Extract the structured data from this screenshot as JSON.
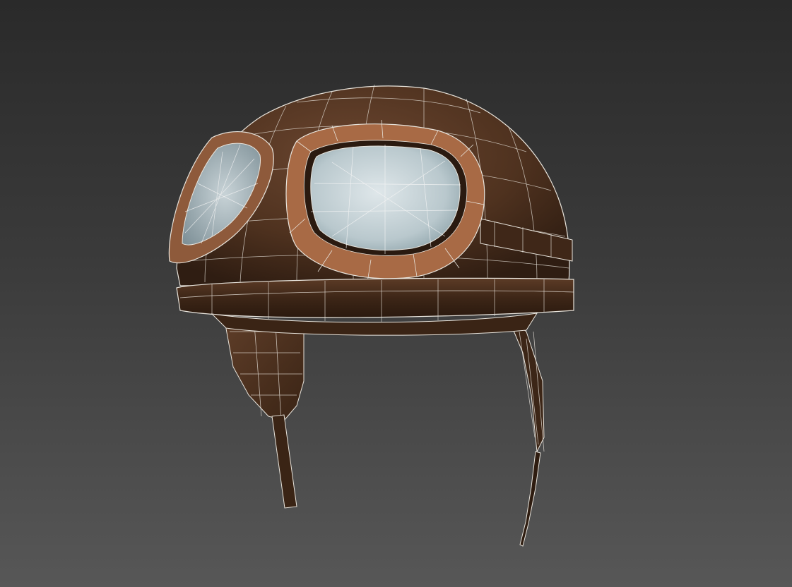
{
  "viewport": {
    "background_top": "#2a2a2a",
    "background_bottom": "#575757",
    "wire_color": "#e8e4dc"
  },
  "model": {
    "subject": "aviator-helmet-with-goggles",
    "leather_color": "#5a3a24",
    "leather_dark": "#3a2415",
    "goggle_frame_color": "#a86a45",
    "lens_color": "#c9d6da",
    "display_mode": "shaded-with-wireframe"
  }
}
